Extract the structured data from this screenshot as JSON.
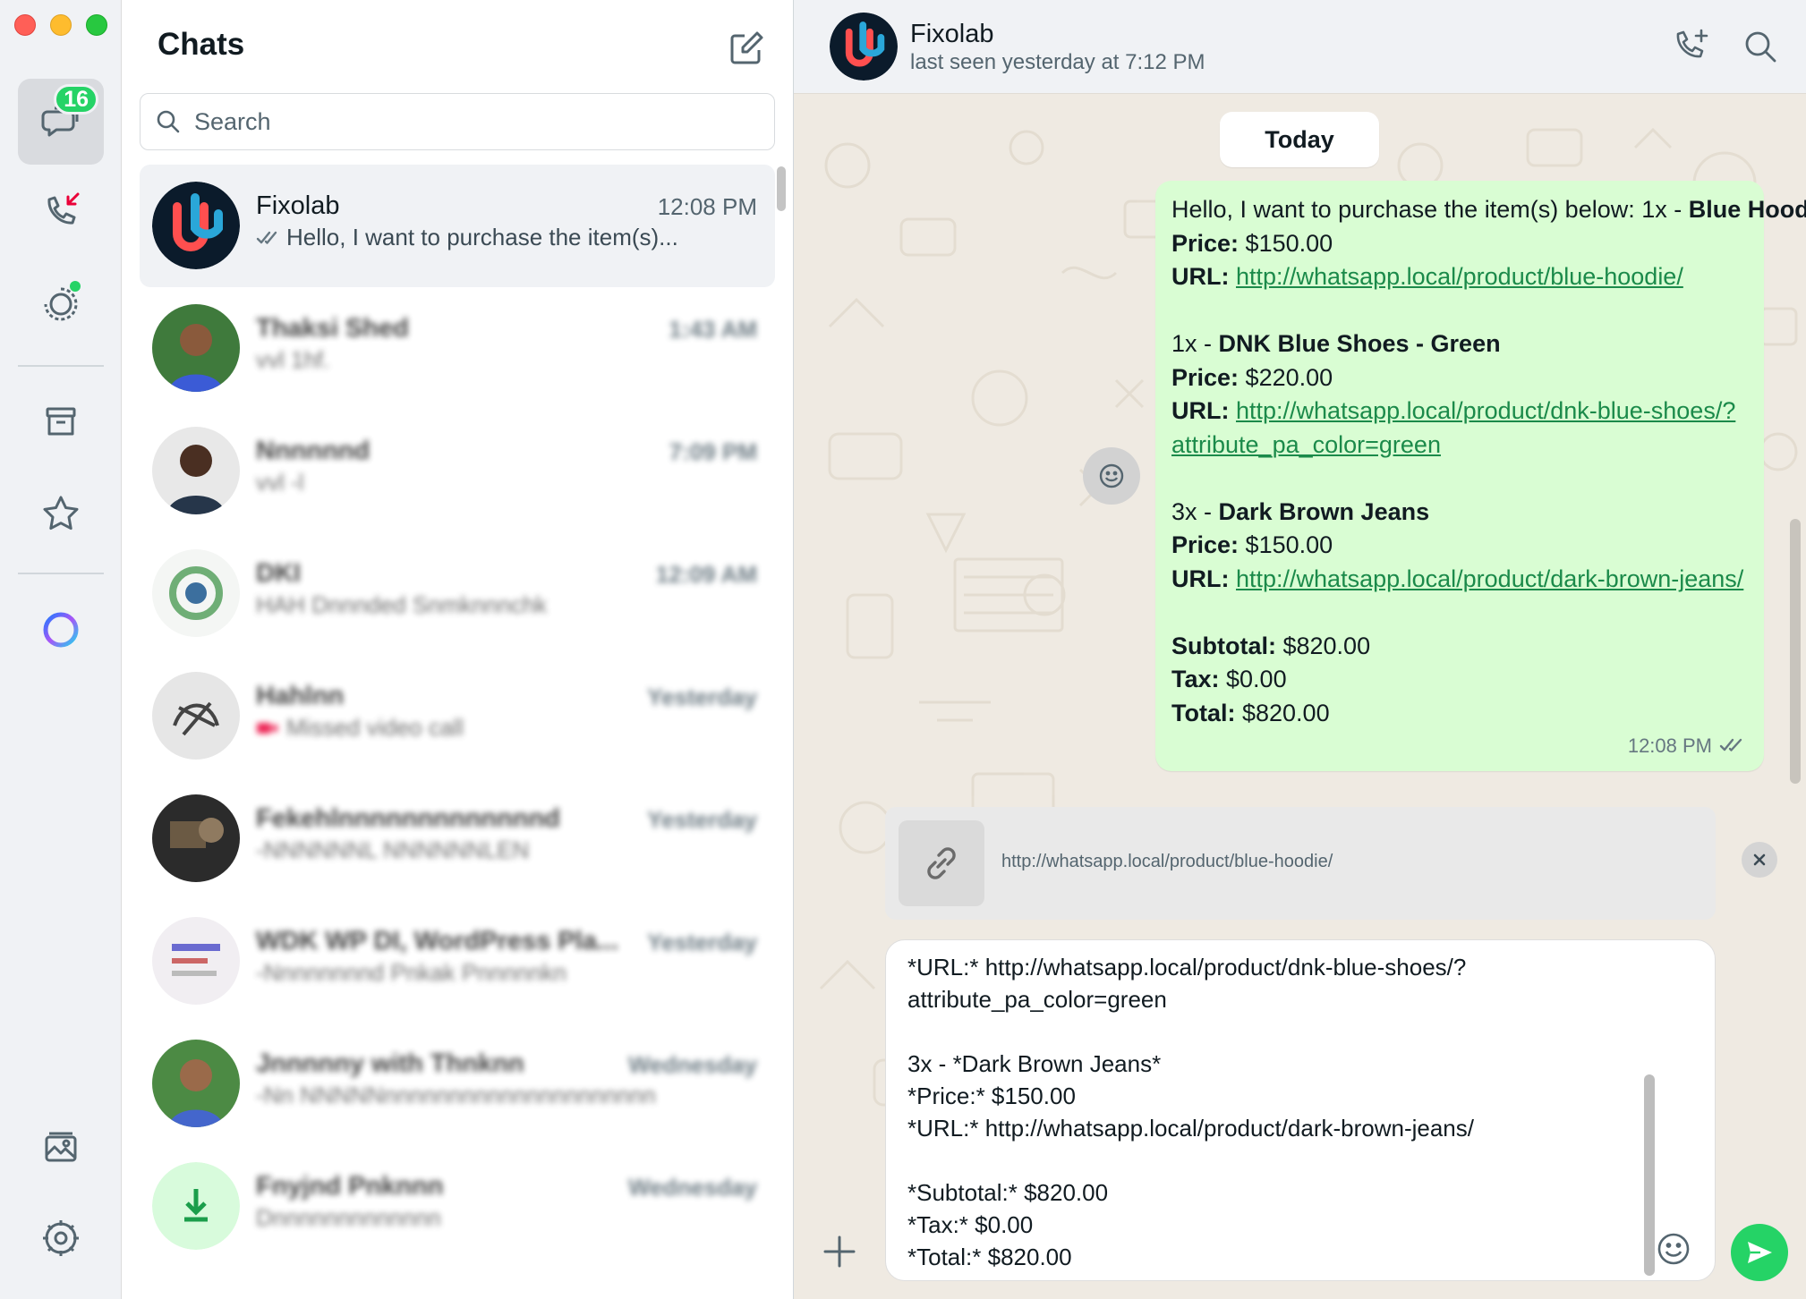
{
  "window": {
    "controls": [
      "close",
      "minimize",
      "zoom"
    ]
  },
  "rail": {
    "chats_badge": "16",
    "icons": [
      "chats-icon",
      "calls-icon",
      "status-icon",
      "archive-icon",
      "starred-icon",
      "meta-ai-icon",
      "media-icon",
      "settings-icon"
    ]
  },
  "list": {
    "title": "Chats",
    "search_placeholder": "Search",
    "chats": [
      {
        "name": "Fixolab",
        "time": "12:08 PM",
        "preview": "Hello, I want to purchase the item(s)..."
      },
      {
        "name": "Thaksi Shed",
        "time": "1:43 AM",
        "preview": "vvl 1hf."
      },
      {
        "name": "Nnnnnnd",
        "time": "7:09 PM",
        "preview": "vvl -l"
      },
      {
        "name": "DKI",
        "time": "12:09 AM",
        "preview": "HAH Dnnnded Snmknnnchk"
      },
      {
        "name": "Hahlnn",
        "time": "Yesterday",
        "preview": "Missed video call"
      },
      {
        "name": "Fekehlnnnnnnnnnnnnnd",
        "time": "Yesterday",
        "preview": "-NNNNNNL NNNNNNLEN"
      },
      {
        "name": "WDK WP DI, WordPress Pla...",
        "time": "Yesterday",
        "preview": "-Nnnnnnnnd Pnkak Pnnnnnkn"
      },
      {
        "name": "Jnnnnny with Thnknn",
        "time": "Wednesday",
        "preview": "-Nn NNNNNnnnnnnnnnnnnnnnnnnnnn"
      },
      {
        "name": "Fnyjnd Pnknnn",
        "time": "Wednesday",
        "preview": "Dnnnnnnnnnnnnn"
      }
    ]
  },
  "conversation": {
    "name": "Fixolab",
    "status": "last seen yesterday at 7:12 PM",
    "day_label": "Today",
    "message": {
      "intro": "Hello, I want to purchase the item(s) below: 1x - ",
      "item1_name": "Blue Hoodie",
      "price_label": "Price:",
      "url_label": "URL:",
      "item1_price": " $150.00",
      "item1_url": "http://whatsapp.local/product/blue-hoodie/",
      "item2_qty": "1x - ",
      "item2_name": "DNK Blue Shoes - Green",
      "item2_price": " $220.00",
      "item2_url_line1": "http://whatsapp.local/product/dnk-blue-shoes/?",
      "item2_url_line2": "attribute_pa_color=green",
      "item3_qty": "3x - ",
      "item3_name": "Dark Brown Jeans",
      "item3_price": " $150.00",
      "item3_url": "http://whatsapp.local/product/dark-brown-jeans/",
      "subtotal_label": "Subtotal:",
      "subtotal": " $820.00",
      "tax_label": "Tax:",
      "tax": " $0.00",
      "total_label": "Total:",
      "total": " $820.00",
      "time": "12:08 PM"
    },
    "link_preview_url": "http://whatsapp.local/product/blue-hoodie/",
    "composer_text": "*URL:* http://whatsapp.local/product/dnk-blue-shoes/?\nattribute_pa_color=green\n\n3x - *Dark Brown Jeans*\n*Price:* $150.00\n*URL:* http://whatsapp.local/product/dark-brown-jeans/\n\n*Subtotal:* $820.00\n*Tax:* $0.00\n*Total:* $820.00"
  },
  "colors": {
    "accent": "#25d366",
    "bubble": "#d9fdd3",
    "link": "#1b8a4a",
    "wallpaper": "#efeae2"
  }
}
